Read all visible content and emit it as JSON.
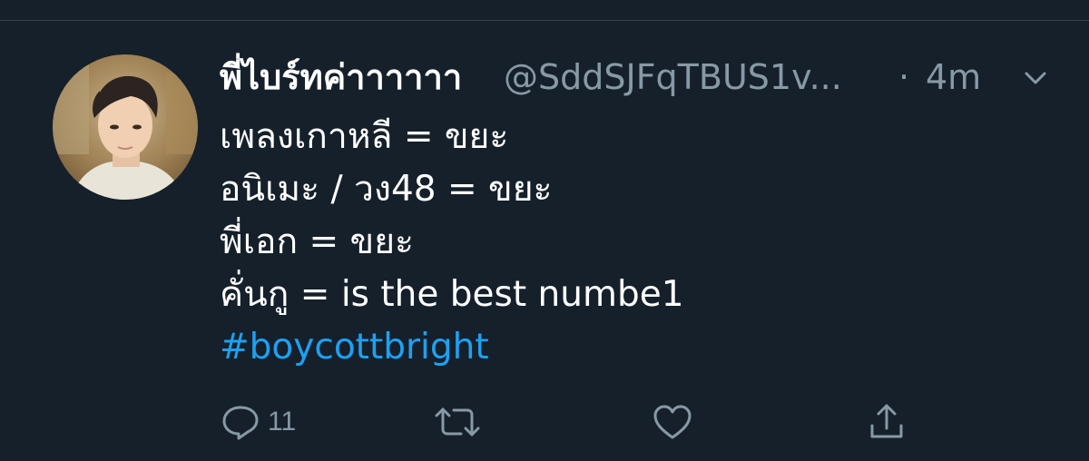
{
  "tweet": {
    "display_name": "พี่ไบร์ทค่าาาาาา",
    "handle": "@SddSJFqTBUS1v...",
    "separator": "·",
    "time": "4m",
    "lines": [
      "เพลงเกาหลี = ขยะ",
      "อนิเมะ / วง48 = ขยะ",
      "พี่เอก = ขยะ",
      "คั่นกู = is the best numbe1"
    ],
    "hashtag": "#boycottbright"
  },
  "actions": {
    "reply_count": "11",
    "retweet_count": "",
    "like_count": ""
  },
  "icons": {
    "caret": "chevron-down-icon",
    "reply": "reply-icon",
    "retweet": "retweet-icon",
    "like": "heart-icon",
    "share": "share-icon"
  },
  "colors": {
    "background": "#15202b",
    "text": "#ffffff",
    "muted": "#8899a6",
    "link": "#1da1f2",
    "divider": "#38444d"
  }
}
